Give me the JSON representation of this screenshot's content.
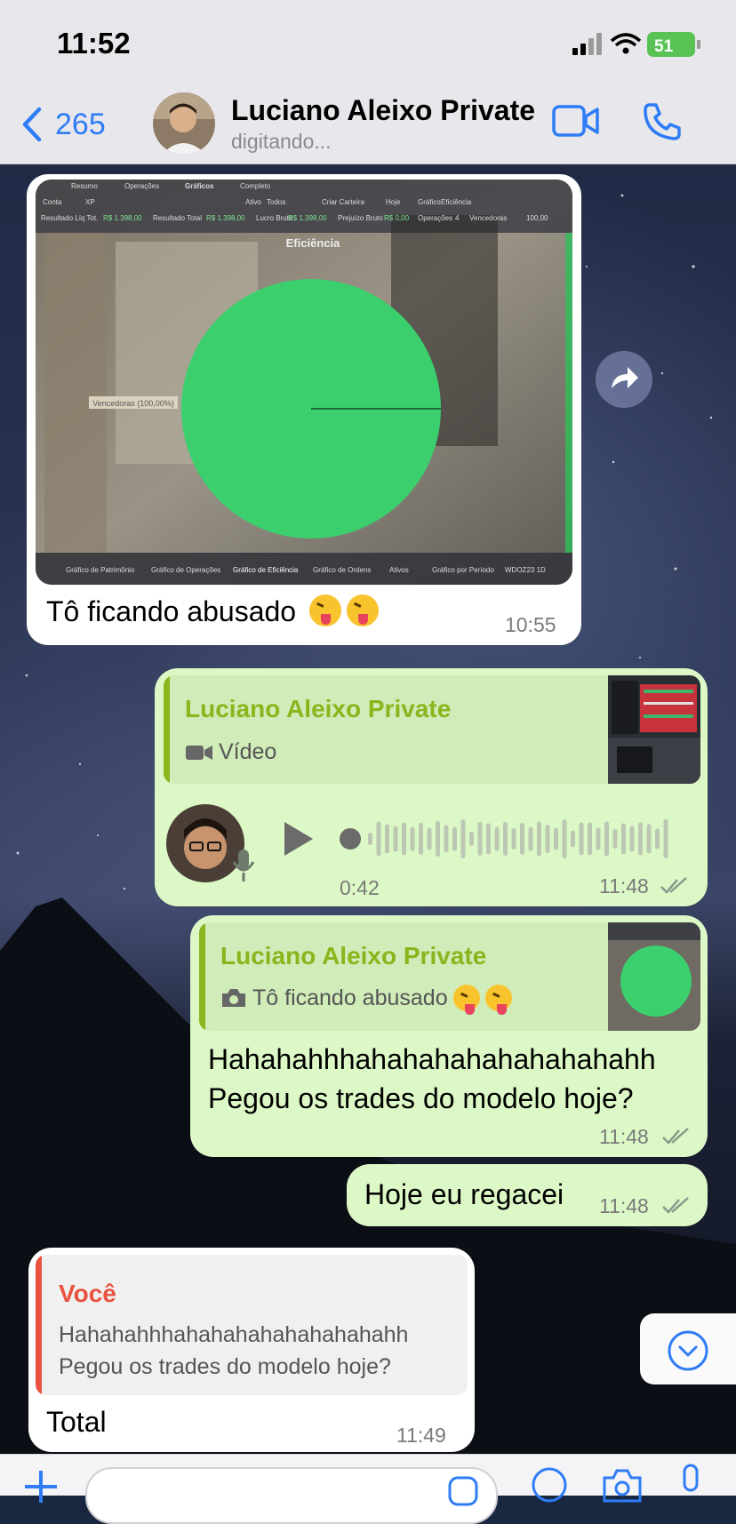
{
  "status_bar": {
    "time": "11:52",
    "battery": "51"
  },
  "header": {
    "back_count": "265",
    "contact_name": "Luciano Aleixo Private",
    "contact_status": "digitando..."
  },
  "messages": {
    "m1": {
      "caption": "Tô ficando abusado",
      "time": "10:55",
      "chart_screen": {
        "title": "Eficiência",
        "slice_label": "Vencedoras (100,00%)",
        "top_labels": [
          "Resumo",
          "Operações",
          "Gráficos",
          "Completo"
        ],
        "toolbar": [
          "Conta",
          "XP",
          "Ativo",
          "Todos",
          "Criar Carteira",
          "Hoje",
          "Gráfico",
          "Eficiência"
        ],
        "stats": [
          "Resultado Líq Tot.",
          "R$ 1.398,00",
          "Resultado Total",
          "R$ 1.398,00",
          "Lucro Bruto",
          "R$ 1.398,00",
          "Prejuízo Bruto",
          "R$ 0,00",
          "Operações",
          "4",
          "Vencedoras",
          "100,00"
        ],
        "bottom_tabs": [
          "Gráfico de Patrimônio",
          "Gráfico de Operações",
          "Gráfico de Eficiência",
          "Gráfico de Ordens",
          "Ativos",
          "Gráfico por Período",
          "WDOZ23 1D"
        ]
      }
    },
    "m2": {
      "reply_name": "Luciano Aleixo Private",
      "reply_type": "Vídeo",
      "duration": "0:42",
      "time": "11:48"
    },
    "m3": {
      "reply_name": "Luciano Aleixo Private",
      "reply_text": "Tô ficando abusado",
      "line1": "Hahahahhhahahahahahahahahahh",
      "line2": "Pegou os trades do modelo hoje?",
      "time": "11:48"
    },
    "m4": {
      "text": "Hoje eu regacei",
      "time": "11:48"
    },
    "m5": {
      "reply_name": "Você",
      "reply_line1": "Hahahahhhahahahahahahahahahh",
      "reply_line2": "Pegou os trades do modelo hoje?",
      "text": "Total",
      "time": "11:49"
    }
  },
  "colors": {
    "accent": "#2e7cf6",
    "reply_green": "#8ab51d",
    "reply_red": "#e8523f",
    "bubble_out": "#dcf8c6"
  },
  "icons": [
    "back-chevron-icon",
    "video-call-icon",
    "phone-call-icon",
    "forward-icon",
    "play-icon",
    "mic-icon",
    "camera-icon",
    "double-check-icon",
    "scroll-down-icon",
    "plus-icon",
    "sticker-icon",
    "payment-icon"
  ]
}
